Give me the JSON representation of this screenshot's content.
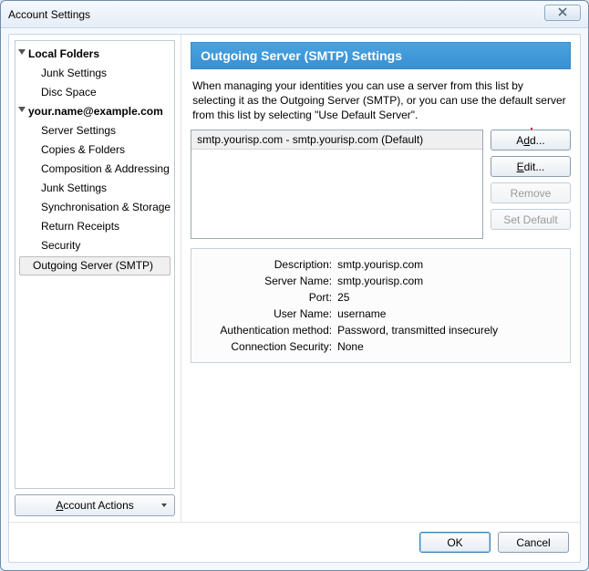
{
  "window": {
    "title": "Account Settings"
  },
  "sidebar": {
    "local_folders_label": "Local Folders",
    "local_children": [
      "Junk Settings",
      "Disc Space"
    ],
    "account_label": "your.name@example.com",
    "account_children": [
      "Server Settings",
      "Copies & Folders",
      "Composition & Addressing",
      "Junk Settings",
      "Synchronisation & Storage",
      "Return Receipts",
      "Security"
    ],
    "outgoing_label": "Outgoing Server (SMTP)",
    "account_actions_label": "Account Actions"
  },
  "main": {
    "banner_title": "Outgoing Server (SMTP) Settings",
    "description_text": "When managing your identities you can use a server from this list by selecting it as the Outgoing Server (SMTP), or you can use the default server from this list by selecting \"Use Default Server\".",
    "server_list_item": "smtp.yourisp.com - smtp.yourisp.com (Default)",
    "buttons": {
      "add": "Add...",
      "edit": "Edit...",
      "remove": "Remove",
      "set_default": "Set Default"
    },
    "details": {
      "labels": {
        "description": "Description:",
        "server_name": "Server Name:",
        "port": "Port:",
        "user_name": "User Name:",
        "auth_method": "Authentication method:",
        "conn_security": "Connection Security:"
      },
      "values": {
        "description": "smtp.yourisp.com",
        "server_name": "smtp.yourisp.com",
        "port": "25",
        "user_name": "username",
        "auth_method": "Password, transmitted insecurely",
        "conn_security": "None"
      }
    }
  },
  "footer": {
    "ok": "OK",
    "cancel": "Cancel"
  }
}
